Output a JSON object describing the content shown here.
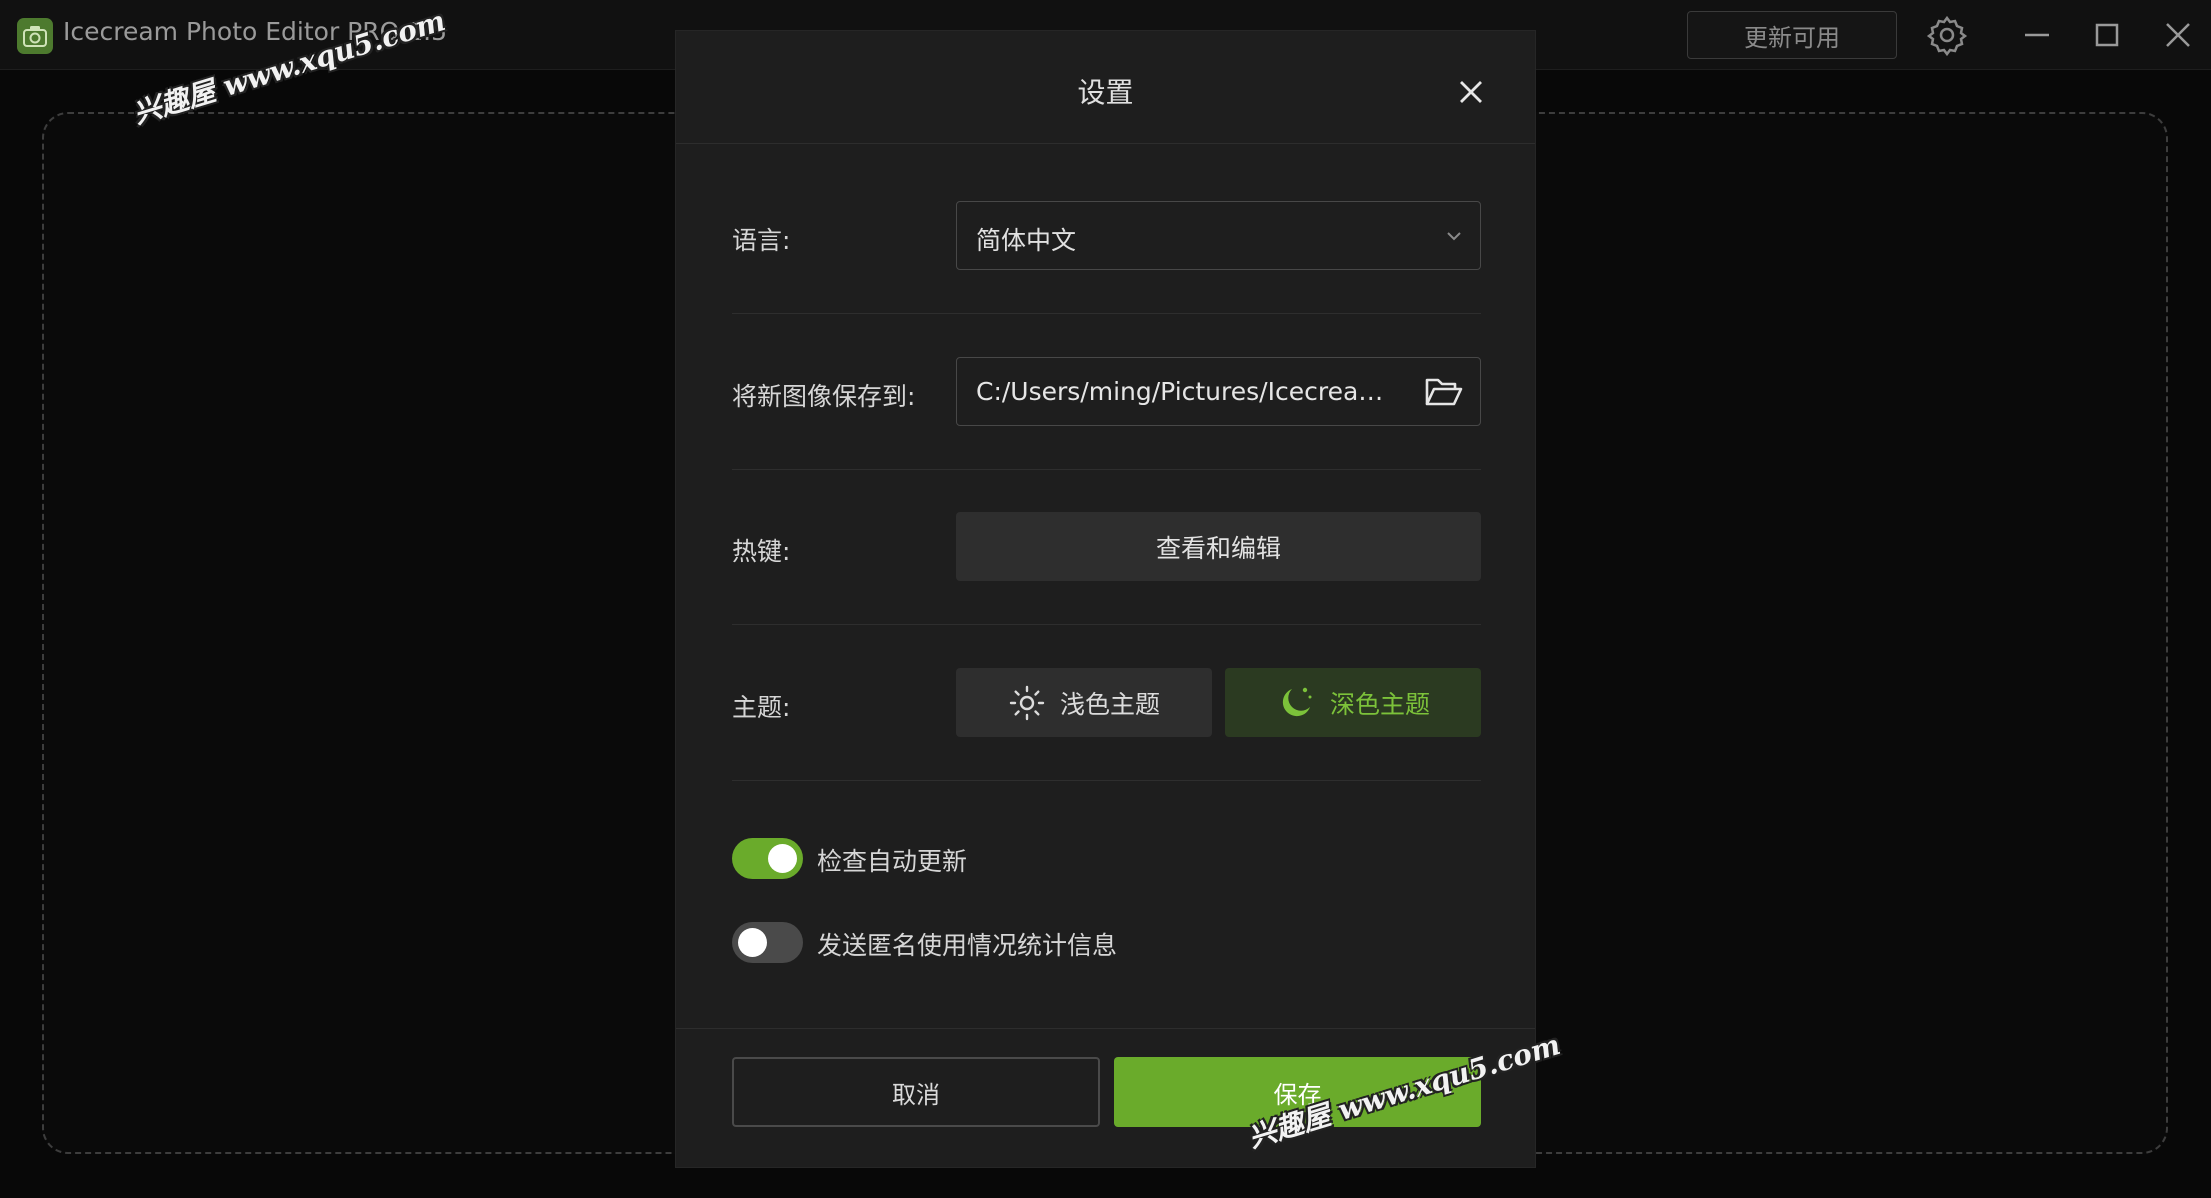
{
  "app": {
    "title": "Icecream Photo Editor PRO 1.5",
    "update_label": "更新可用"
  },
  "watermark_text": "兴趣屋 www.xqu5.com",
  "dialog": {
    "title": "设置",
    "language": {
      "label": "语言:",
      "selected": "简体中文"
    },
    "save_path": {
      "label": "将新图像保存到:",
      "value": "C:/Users/ming/Pictures/Icecream Phot..."
    },
    "hotkeys": {
      "label": "热键:",
      "button_label": "查看和编辑"
    },
    "theme": {
      "label": "主题:",
      "light_label": "浅色主题",
      "dark_label": "深色主题",
      "selected": "dark"
    },
    "toggles": [
      {
        "label": "检查自动更新",
        "on": true
      },
      {
        "label": "发送匿名使用情况统计信息",
        "on": false
      }
    ],
    "cancel_label": "取消",
    "save_label": "保存"
  },
  "colors": {
    "accent": "#6aab2b",
    "dialog_bg": "#1e1e1e",
    "window_bg": "#080808"
  },
  "icons": {
    "app_logo": "camera-icon",
    "settings": "gear-icon",
    "minimize": "minimize-icon",
    "maximize": "maximize-icon",
    "close": "close-icon",
    "dropdown": "chevron-down-icon",
    "folder": "folder-open-icon",
    "light_theme": "sun-icon",
    "dark_theme": "moon-icon"
  }
}
